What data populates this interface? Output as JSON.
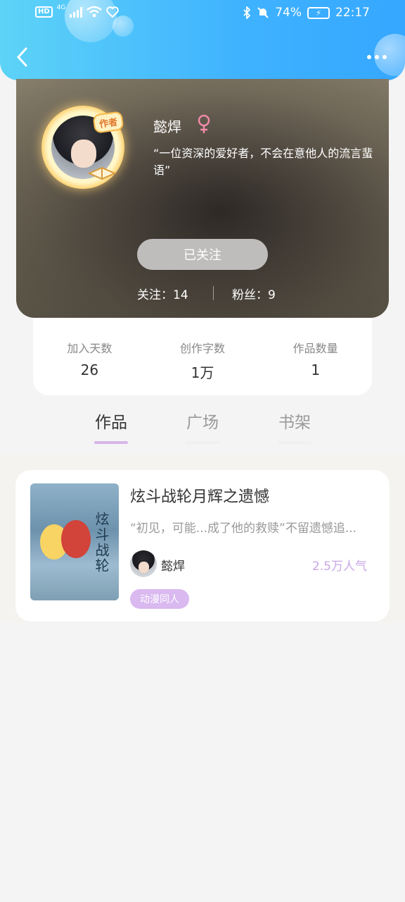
{
  "status_bar": {
    "network_label": "4G",
    "hd_label": "HD",
    "battery_text": "74%",
    "time": "22:17"
  },
  "header": {
    "back_icon": "chevron-left-icon",
    "more_icon": "more-dots-icon"
  },
  "profile": {
    "name": "懿焊",
    "badge": "作者",
    "gender_icon": "female-icon",
    "bio": "“一位资深的爱好者，不会在意他人的流言蜚语”",
    "follow_button": "已关注",
    "following_label": "关注：14",
    "followers_label": "粉丝：9"
  },
  "stats": [
    {
      "label": "加入天数",
      "value": "26"
    },
    {
      "label": "创作字数",
      "value": "1万"
    },
    {
      "label": "作品数量",
      "value": "1"
    }
  ],
  "tabs": [
    {
      "label": "作品",
      "active": true
    },
    {
      "label": "广场",
      "active": false
    },
    {
      "label": "书架",
      "active": false
    }
  ],
  "works": [
    {
      "title": "炫斗战轮月辉之遗憾",
      "description": "“初见，可能...成了他的救赎”不留遗憾追...",
      "author": "懿焊",
      "popularity": "2.5万人气",
      "tag": "动漫同人",
      "cover_text": "炫斗战轮"
    }
  ],
  "colors": {
    "header_blue": "#3fb2ff",
    "accent_purple": "#d9b9ef",
    "popularity_purple": "#c9a7e6"
  }
}
